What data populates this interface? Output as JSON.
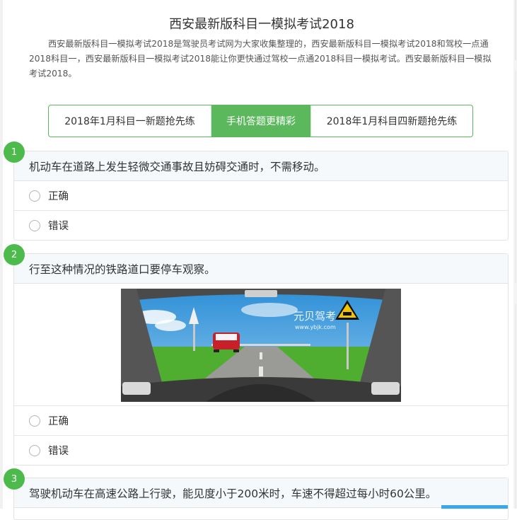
{
  "page": {
    "title": "西安最新版科目一模拟考试2018",
    "intro": "西安最新版科目一模拟考试2018是驾驶员考试网为大家收集整理的，西安最新版科目一模拟考试2018和驾校一点通2018科目一，西安最新版科目一模拟考试2018能让你更快通过驾校一点通2018科目一模拟考试。西安最新版科目一模拟考试2018。"
  },
  "tabs": [
    {
      "label": "2018年1月科目一新题抢先练",
      "active": false
    },
    {
      "label": "手机答题更精彩",
      "active": true
    },
    {
      "label": "2018年1月科目四新题抢先练",
      "active": false
    }
  ],
  "questions": [
    {
      "number": "1",
      "text": "机动车在道路上发生轻微交通事故且妨碍交通时，不需移动。",
      "options": [
        "正确",
        "错误"
      ]
    },
    {
      "number": "2",
      "text": "行至这种情况的铁路道口要停车观察。",
      "options": [
        "正确",
        "错误"
      ],
      "image": {
        "watermark_title": "元贝驾考",
        "watermark_url": "www.ybjk.com"
      }
    },
    {
      "number": "3",
      "text": "驾驶机动车在高速公路上行驶，能见度小于200米时，车速不得超过每小时60公里。",
      "options": []
    }
  ],
  "colors": {
    "accent": "#5cb85c",
    "badge": "#4cbb4c",
    "question_bg": "#f5f9fc",
    "link_blue": "#3aa8e8"
  }
}
